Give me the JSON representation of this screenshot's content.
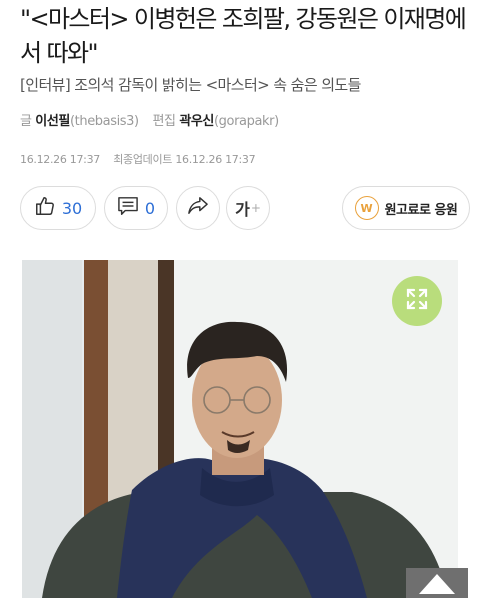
{
  "article": {
    "title": "\"<마스터> 이병헌은 조희팔, 강동원은 이재명에서 따와\"",
    "subtitle": "[인터뷰] 조의석 감독이 밝히는 <마스터> 속 숨은 의도들",
    "byline": {
      "writer_prefix": "글",
      "writer_name": "이선필",
      "writer_id": "(thebasis3)",
      "editor_prefix": "편집",
      "editor_name": "곽우신",
      "editor_id": "(gorapakr)"
    },
    "dates": {
      "published": "16.12.26 17:37",
      "updated_label": "최종업데이트",
      "updated": "16.12.26 17:37"
    }
  },
  "actions": {
    "like_count": "30",
    "comment_count": "0",
    "font_label": "가",
    "font_plus": "+",
    "support_label": "원고료로 응원",
    "support_icon_letter": "W"
  },
  "colors": {
    "count_blue": "#2e6fd6",
    "expand_green": "#b9dd7c",
    "support_orange": "#e9a13b"
  },
  "icons": [
    "thumbs-up-icon",
    "comment-icon",
    "share-icon",
    "expand-icon",
    "arrow-up-icon"
  ]
}
